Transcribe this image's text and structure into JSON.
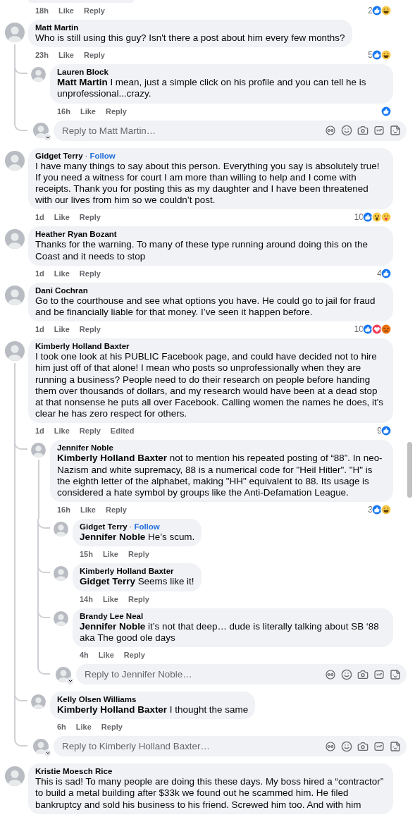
{
  "comments": [
    {
      "kind": "partial",
      "time": "18h",
      "actions": [
        "Like",
        "Reply"
      ],
      "reactions": {
        "count": "2",
        "icons": [
          {
            "kind": "like"
          },
          {
            "kind": "haha"
          }
        ]
      }
    },
    {
      "kind": "comment",
      "author": "Matt Martin",
      "text": "Who is still using this guy? Isn't there a post about him every few months?",
      "time": "23h",
      "actions": [
        "Like",
        "Reply"
      ],
      "reactions": {
        "count": "5",
        "icons": [
          {
            "kind": "like"
          },
          {
            "kind": "haha"
          }
        ]
      },
      "replies": [
        {
          "author": "Lauren Block",
          "text": "**Matt Martin** I mean, just a simple click on his profile and you can tell he is unprofessional...crazy.",
          "time": "16h",
          "actions": [
            "Like",
            "Reply"
          ],
          "reactions": {
            "icons": [
              {
                "kind": "like"
              }
            ]
          }
        }
      ],
      "reply_box": {
        "placeholder": "Reply to Matt Martin…"
      }
    },
    {
      "kind": "comment",
      "author": "Gidget Terry",
      "follow": {
        "separator": "·",
        "label": "Follow"
      },
      "text": "I have many things to say about this person. Everything you say is absolutely true! If you need a witness for court I am more than willing to help and I come with receipts. Thank you for posting this as my daughter and I have been threatened with our lives from him so we couldn’t post.",
      "time": "1d",
      "actions": [
        "Like",
        "Reply"
      ],
      "reactions": {
        "count": "10",
        "icons": [
          {
            "kind": "like"
          },
          {
            "kind": "wow"
          },
          {
            "kind": "care"
          }
        ]
      }
    },
    {
      "kind": "comment",
      "author": "Heather Ryan Bozant",
      "text": "Thanks for the warning. To many of these type running around doing this on the Coast and it needs to stop",
      "time": "1d",
      "actions": [
        "Like",
        "Reply"
      ],
      "reactions": {
        "count": "4",
        "icons": [
          {
            "kind": "like"
          }
        ]
      }
    },
    {
      "kind": "comment",
      "author": "Dani Cochran",
      "text": "Go to the courthouse and see what options you have. He could go to jail for fraud and be financially liable for that money. I’ve seen it happen before.",
      "time": "1d",
      "actions": [
        "Like",
        "Reply"
      ],
      "reactions": {
        "count": "10",
        "icons": [
          {
            "kind": "like"
          },
          {
            "kind": "love"
          },
          {
            "kind": "angry"
          }
        ]
      }
    },
    {
      "kind": "comment",
      "author": "Kimberly Holland Baxter",
      "text": "I took one look at his PUBLIC Facebook page, and could have decided not to hire him just off of that alone! I mean who posts so unprofessionally when they are running a business? People need to do their research on people before handing them over thousands of dollars, and my research would have been at a dead stop at that nonsense he puts all over Facebook. Calling women the names he does, it's clear he has zero respect for others.",
      "time": "1d",
      "actions": [
        "Like",
        "Reply"
      ],
      "edited": "Edited",
      "reactions": {
        "count": "9",
        "icons": [
          {
            "kind": "like"
          }
        ]
      },
      "replies": [
        {
          "author": "Jennifer Noble",
          "text": "**Kimberly Holland Baxter** not to mention his repeated posting of “88”. In neo-Nazism and white supremacy, 88 is a numerical code for \"Heil Hitler\". \"H\" is the eighth letter of the alphabet, making \"HH\" equivalent to 88. Its usage is considered a hate symbol by groups like the Anti-Defamation League.",
          "time": "16h",
          "actions": [
            "Like",
            "Reply"
          ],
          "reactions": {
            "count": "3",
            "icons": [
              {
                "kind": "like"
              },
              {
                "kind": "haha"
              }
            ]
          },
          "replies": [
            {
              "author": "Gidget Terry",
              "follow": {
                "separator": "·",
                "label": "Follow"
              },
              "text": "**Jennifer Noble** He’s scum.",
              "time": "15h",
              "actions": [
                "Like",
                "Reply"
              ]
            },
            {
              "author": "Kimberly Holland Baxter",
              "text": "**Gidget Terry** Seems like it!",
              "time": "14h",
              "actions": [
                "Like",
                "Reply"
              ]
            },
            {
              "author": "Brandy Lee Neal",
              "text": "**Jennifer Noble** it’s not that deep… dude is literally talking about SB ‘88 aka The good ole days",
              "time": "4h",
              "actions": [
                "Like",
                "Reply"
              ]
            }
          ],
          "reply_box": {
            "placeholder": "Reply to Jennifer Noble…"
          }
        },
        {
          "author": "Kelly Olsen Williams",
          "text": "**Kimberly Holland Baxter** I thought the same",
          "time": "6h",
          "actions": [
            "Like",
            "Reply"
          ]
        }
      ],
      "reply_box": {
        "placeholder": "Reply to Kimberly Holland Baxter…"
      }
    },
    {
      "kind": "comment",
      "author": "Kristie Moesch Rice",
      "text": "This is sad! To many people are doing this these days. My boss hired a “contractor” to build a metal building after $33k we found out he scammed him. He filed bankruptcy and sold his business to his friend. Screwed him too. And with him"
    }
  ]
}
